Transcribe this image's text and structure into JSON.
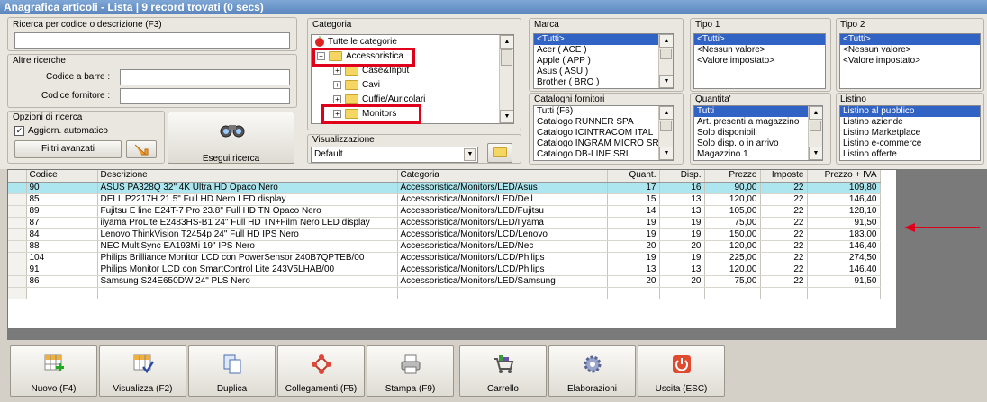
{
  "window": {
    "title": "Anagrafica articoli  - Lista | 9 record trovati (0 secs)"
  },
  "search": {
    "label": "Ricerca per codice o descrizione (F3)",
    "value": "",
    "altre_label": "Altre ricerche",
    "barcode_label": "Codice a barre :",
    "supplier_code_label": "Codice fornitore :",
    "options_label": "Opzioni di ricerca",
    "auto_update_label": "Aggiorn. automatico",
    "auto_update_checked": true,
    "advanced_filters_label": "Filtri avanzati",
    "run_search_label": "Esegui ricerca"
  },
  "categoria": {
    "label": "Categoria",
    "root": "Tutte le categorie",
    "nodes": [
      "Accessoristica",
      "Case&Input",
      "Cavi",
      "Cuffie/Auricolari",
      "Monitors"
    ]
  },
  "visualizzazione": {
    "label": "Visualizzazione",
    "value": "Default"
  },
  "marca": {
    "label": "Marca",
    "items": [
      "<Tutti>",
      "Acer ( ACE )",
      "Apple ( APP )",
      "Asus ( ASU )",
      "Brother ( BRO )"
    ]
  },
  "tipo1": {
    "label": "Tipo 1",
    "items": [
      "<Tutti>",
      "<Nessun valore>",
      "<Valore impostato>"
    ]
  },
  "tipo2": {
    "label": "Tipo 2",
    "items": [
      "<Tutti>",
      "<Nessun valore>",
      "<Valore impostato>"
    ]
  },
  "cataloghi": {
    "label": "Cataloghi fornitori",
    "items": [
      "Tutti (F6)",
      "Catalogo RUNNER SPA",
      "Catalogo ICINTRACOM ITAL",
      "Catalogo INGRAM MICRO SRL",
      "Catalogo DB-LINE SRL"
    ]
  },
  "quantita": {
    "label": "Quantita'",
    "items": [
      "Tutti",
      "Art. presenti a magazzino",
      "Solo disponibili",
      "Solo disp. o in arrivo",
      "Magazzino 1"
    ]
  },
  "listino": {
    "label": "Listino",
    "items": [
      "Listino al pubblico",
      "Listino aziende",
      "Listino Marketplace",
      "Listino e-commerce",
      "Listino offerte"
    ]
  },
  "table": {
    "columns": [
      "Codice",
      "Descrizione",
      "Categoria",
      "Quant.",
      "Disp.",
      "Prezzo",
      "Imposte",
      "Prezzo + IVA"
    ],
    "rows": [
      [
        "90",
        "ASUS PA328Q 32\" 4K Ultra HD Opaco Nero",
        "Accessoristica/Monitors/LED/Asus",
        "17",
        "16",
        "90,00",
        "22",
        "109,80"
      ],
      [
        "85",
        "DELL P2217H 21.5\" Full HD Nero LED display",
        "Accessoristica/Monitors/LED/Dell",
        "15",
        "13",
        "120,00",
        "22",
        "146,40"
      ],
      [
        "89",
        "Fujitsu E line E24T-7 Pro 23.8\" Full HD TN Opaco Nero",
        "Accessoristica/Monitors/LED/Fujitsu",
        "14",
        "13",
        "105,00",
        "22",
        "128,10"
      ],
      [
        "87",
        "iiyama ProLite E2483HS-B1 24\" Full HD TN+Film Nero LED display",
        "Accessoristica/Monitors/LED/Iiyama",
        "19",
        "19",
        "75,00",
        "22",
        "91,50"
      ],
      [
        "84",
        "Lenovo ThinkVision T2454p 24\" Full HD IPS Nero",
        "Accessoristica/Monitors/LCD/Lenovo",
        "19",
        "19",
        "150,00",
        "22",
        "183,00"
      ],
      [
        "88",
        "NEC MultiSync EA193Mi 19\" IPS Nero",
        "Accessoristica/Monitors/LED/Nec",
        "20",
        "20",
        "120,00",
        "22",
        "146,40"
      ],
      [
        "104",
        "Philips Brilliance Monitor LCD con PowerSensor 240B7QPTEB/00",
        "Accessoristica/Monitors/LCD/Philips",
        "19",
        "19",
        "225,00",
        "22",
        "274,50"
      ],
      [
        "91",
        "Philips Monitor LCD con SmartControl Lite 243V5LHAB/00",
        "Accessoristica/Monitors/LCD/Philips",
        "13",
        "13",
        "120,00",
        "22",
        "146,40"
      ],
      [
        "86",
        "Samsung S24E650DW 24\" PLS Nero",
        "Accessoristica/Monitors/LED/Samsung",
        "20",
        "20",
        "75,00",
        "22",
        "91,50"
      ]
    ]
  },
  "toolbar": {
    "buttons": [
      "Nuovo (F4)",
      "Visualizza (F2)",
      "Duplica",
      "Collegamenti (F5)",
      "Stampa (F9)",
      "Carrello",
      "Elaborazioni",
      "Uscita (ESC)"
    ]
  },
  "colors": {
    "highlight_row": "#ade6ee",
    "selection": "#3163c5",
    "annotation_red": "#e0001b"
  }
}
